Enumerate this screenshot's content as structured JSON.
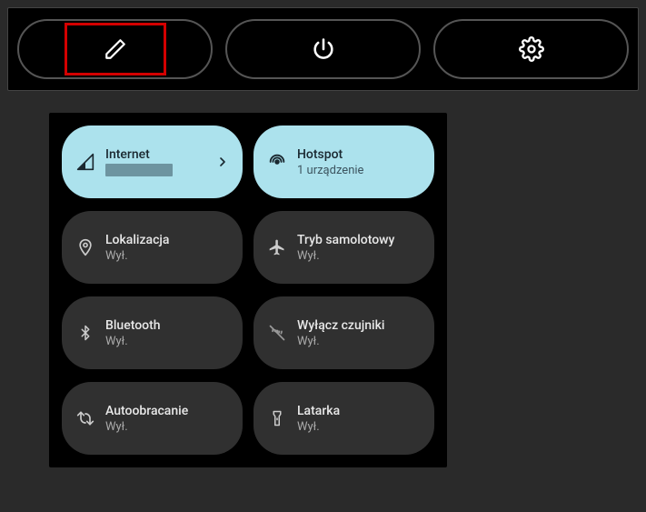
{
  "topbar": {
    "buttons": [
      {
        "name": "edit-button",
        "icon": "pencil-icon",
        "highlighted": true
      },
      {
        "name": "power-button",
        "icon": "power-icon",
        "highlighted": false
      },
      {
        "name": "settings-button",
        "icon": "gear-icon",
        "highlighted": false
      }
    ]
  },
  "tiles": [
    {
      "name": "internet-tile",
      "icon": "signal-icon",
      "title": "Internet",
      "sub": "",
      "active": true,
      "redactedSub": true,
      "chevron": true
    },
    {
      "name": "hotspot-tile",
      "icon": "hotspot-icon",
      "title": "Hotspot",
      "sub": "1 urządzenie",
      "active": true
    },
    {
      "name": "location-tile",
      "icon": "location-icon",
      "title": "Lokalizacja",
      "sub": "Wył.",
      "active": false
    },
    {
      "name": "airplane-tile",
      "icon": "airplane-icon",
      "title": "Tryb samolotowy",
      "sub": "Wył.",
      "active": false
    },
    {
      "name": "bluetooth-tile",
      "icon": "bluetooth-icon",
      "title": "Bluetooth",
      "sub": "Wył.",
      "active": false
    },
    {
      "name": "sensors-tile",
      "icon": "sensors-off-icon",
      "title": "Wyłącz czujniki",
      "sub": "Wył.",
      "active": false
    },
    {
      "name": "autorotate-tile",
      "icon": "rotate-icon",
      "title": "Autoobracanie",
      "sub": "Wył.",
      "active": false
    },
    {
      "name": "flashlight-tile",
      "icon": "flashlight-icon",
      "title": "Latarka",
      "sub": "Wył.",
      "active": false
    }
  ]
}
